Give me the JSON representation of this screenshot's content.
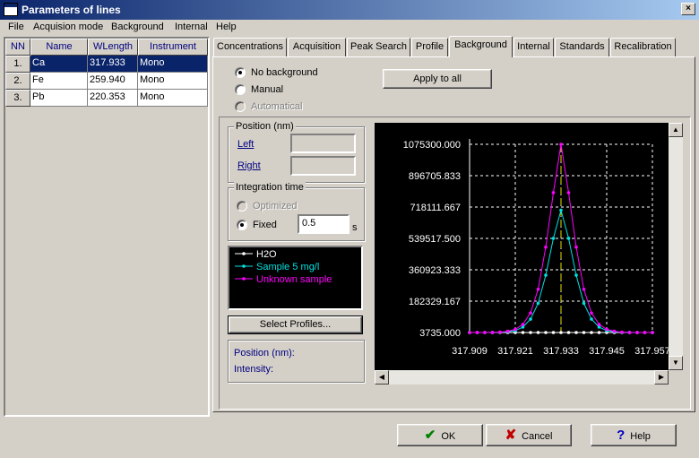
{
  "window": {
    "title": "Parameters of lines"
  },
  "menu": [
    "File",
    "Acquision mode",
    "Background",
    "Internal",
    "Help"
  ],
  "grid": {
    "headers": [
      "NN",
      "Name",
      "WLength",
      "Instrument"
    ],
    "rows": [
      {
        "nn": "1.",
        "name": "Ca",
        "wl": "317.933",
        "inst": "Mono"
      },
      {
        "nn": "2.",
        "name": "Fe",
        "wl": "259.940",
        "inst": "Mono"
      },
      {
        "nn": "3.",
        "name": "Pb",
        "wl": "220.353",
        "inst": "Mono"
      }
    ]
  },
  "tabs": [
    "Concentrations",
    "Acquisition",
    "Peak Search",
    "Profile",
    "Background",
    "Internal",
    "Standards",
    "Recalibration"
  ],
  "background_options": {
    "none": "No background",
    "manual": "Manual",
    "auto": "Automatical"
  },
  "apply_all": "Apply to all",
  "position_group": {
    "title": "Position (nm)",
    "left": "Left",
    "right": "Right",
    "left_value": "",
    "right_value": ""
  },
  "integration_group": {
    "title": "Integration time",
    "optimized": "Optimized",
    "fixed": "Fixed",
    "value": "0.5",
    "unit": "s"
  },
  "legend": [
    "H2O",
    "Sample 5 mg/l",
    "Unknown sample"
  ],
  "select_profiles": "Select Profiles...",
  "info": {
    "position_label": "Position (nm):",
    "intensity_label": "Intensity:"
  },
  "buttons": {
    "ok": "OK",
    "cancel": "Cancel",
    "help": "Help"
  },
  "colors": {
    "h2o": "#ffffff",
    "sample": "#00e0e0",
    "unknown": "#ff00ff",
    "peak_line": "#e0e000",
    "selection": "#0a246a"
  },
  "icons": {
    "ok": "check-icon",
    "cancel": "cross-icon",
    "help": "question-icon"
  },
  "chart_data": {
    "type": "line",
    "x_ticks": [
      "317.909",
      "317.921",
      "317.933",
      "317.945",
      "317.957"
    ],
    "y_ticks": [
      "1075300.000",
      "896705.833",
      "718111.667",
      "539517.500",
      "360923.333",
      "182329.167",
      "3735.000"
    ],
    "xlim": [
      317.909,
      317.957
    ],
    "ylim": [
      3735,
      1075300
    ],
    "peak_x": 317.933,
    "series": [
      {
        "name": "H2O",
        "color": "#ffffff",
        "x": [
          317.909,
          317.911,
          317.913,
          317.915,
          317.917,
          317.919,
          317.921,
          317.923,
          317.925,
          317.927,
          317.929,
          317.931,
          317.933,
          317.935,
          317.937,
          317.939,
          317.941,
          317.943,
          317.945,
          317.947,
          317.949,
          317.951,
          317.953,
          317.955,
          317.957
        ],
        "y": [
          3735,
          3735,
          3735,
          3735,
          3735,
          3735,
          3735,
          3735,
          3735,
          3735,
          3735,
          3735,
          3735,
          3735,
          3735,
          3735,
          3735,
          3735,
          3735,
          3735,
          3735,
          3735,
          3735,
          3735,
          3735
        ]
      },
      {
        "name": "Sample 5 mg/l",
        "color": "#00e0e0",
        "x": [
          317.909,
          317.911,
          317.913,
          317.915,
          317.917,
          317.919,
          317.921,
          317.923,
          317.925,
          317.927,
          317.929,
          317.931,
          317.933,
          317.935,
          317.937,
          317.939,
          317.941,
          317.943,
          317.945,
          317.947,
          317.949,
          317.951,
          317.953,
          317.955,
          317.957
        ],
        "y": [
          3735,
          3735,
          3735,
          4000,
          5000,
          8000,
          15000,
          35000,
          80000,
          170000,
          330000,
          540000,
          700000,
          540000,
          330000,
          170000,
          80000,
          35000,
          15000,
          8000,
          5000,
          4000,
          3735,
          3735,
          3735
        ]
      },
      {
        "name": "Unknown sample",
        "color": "#ff00ff",
        "x": [
          317.909,
          317.911,
          317.913,
          317.915,
          317.917,
          317.919,
          317.921,
          317.923,
          317.925,
          317.927,
          317.929,
          317.931,
          317.933,
          317.935,
          317.937,
          317.939,
          317.941,
          317.943,
          317.945,
          317.947,
          317.949,
          317.951,
          317.953,
          317.955,
          317.957
        ],
        "y": [
          3735,
          3735,
          3735,
          4000,
          6000,
          11000,
          22000,
          50000,
          115000,
          250000,
          490000,
          800000,
          1075300,
          800000,
          490000,
          250000,
          115000,
          50000,
          22000,
          11000,
          6000,
          4000,
          3735,
          3735,
          3735
        ]
      }
    ]
  }
}
